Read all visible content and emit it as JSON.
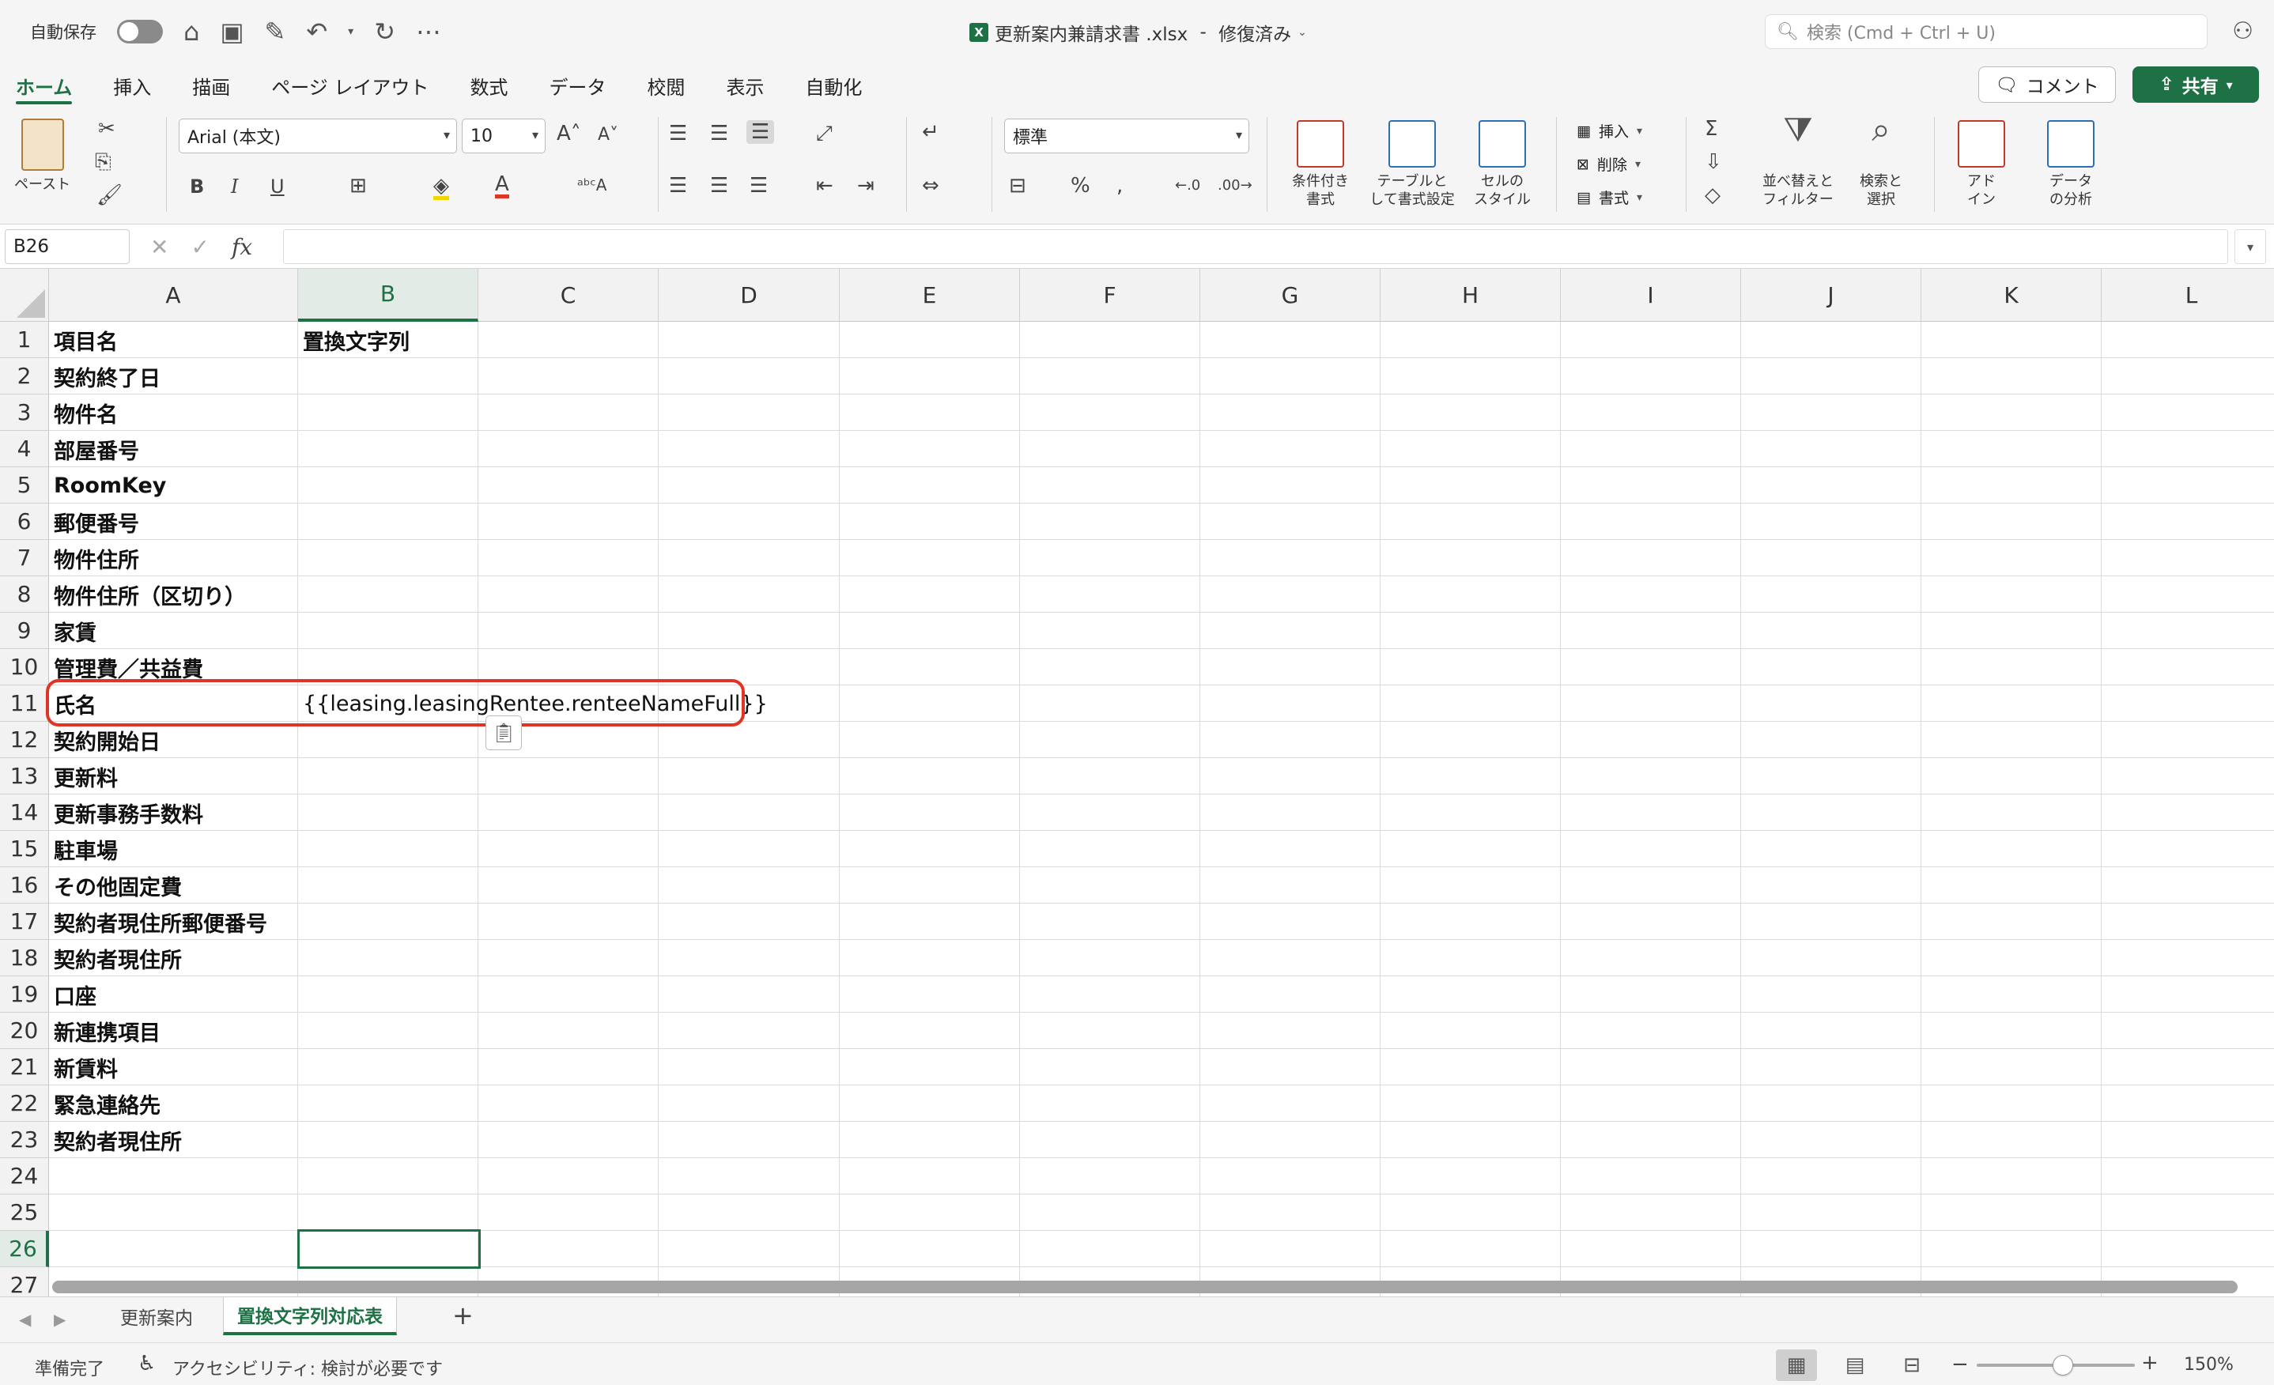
{
  "titlebar": {
    "autosave_label": "自動保存",
    "document_title": "更新案内兼請求書 .xlsx",
    "document_status": "修復済み",
    "search_placeholder": "検索 (Cmd + Ctrl + U)"
  },
  "ribbon_tabs": [
    "ホーム",
    "挿入",
    "描画",
    "ページ レイアウト",
    "数式",
    "データ",
    "校閲",
    "表示",
    "自動化"
  ],
  "active_tab": "ホーム",
  "actions": {
    "comment_label": "コメント",
    "share_label": "共有"
  },
  "ribbon": {
    "paste_label": "ペースト",
    "font_name": "Arial (本文)",
    "font_size": "10",
    "number_format": "標準",
    "conditional_format_label_1": "条件付き",
    "conditional_format_label_2": "書式",
    "table_format_label_1": "テーブルと",
    "table_format_label_2": "して書式設定",
    "cell_style_label_1": "セルの",
    "cell_style_label_2": "スタイル",
    "insert_label": "挿入",
    "delete_label": "削除",
    "format_label": "書式",
    "sort_filter_label_1": "並べ替えと",
    "sort_filter_label_2": "フィルター",
    "find_select_label_1": "検索と",
    "find_select_label_2": "選択",
    "addin_label_1": "アド",
    "addin_label_2": "イン",
    "data_analysis_label_1": "データ",
    "data_analysis_label_2": "の分析"
  },
  "formula_bar": {
    "name_box": "B26",
    "fx_label": "fx",
    "content": ""
  },
  "columns": [
    "A",
    "B",
    "C",
    "D",
    "E",
    "F",
    "G",
    "H",
    "I",
    "J",
    "K",
    "L"
  ],
  "rows": [
    "1",
    "2",
    "3",
    "4",
    "5",
    "6",
    "7",
    "8",
    "9",
    "10",
    "11",
    "12",
    "13",
    "14",
    "15",
    "16",
    "17",
    "18",
    "19",
    "20",
    "21",
    "22",
    "23",
    "24",
    "25",
    "26",
    "27"
  ],
  "cells": {
    "A1": "項目名",
    "B1": "置換文字列",
    "A2": "契約終了日",
    "A3": "物件名",
    "A4": "部屋番号",
    "A5": "RoomKey",
    "A6": "郵便番号",
    "A7": "物件住所",
    "A8": "物件住所（区切り）",
    "A9": "家賃",
    "A10": "管理費／共益費",
    "A11": "氏名",
    "B11": "{{leasing.leasingRentee.renteeNameFull}}",
    "A12": "契約開始日",
    "A13": "更新料",
    "A14": "更新事務手数料",
    "A15": "駐車場",
    "A16": "その他固定費",
    "A17": "契約者現住所郵便番号",
    "A18": "契約者現住所",
    "A19": "口座",
    "A20": "新連携項目",
    "A21": "新賃料",
    "A22": "緊急連絡先",
    "A23": "契約者現住所"
  },
  "selected_cell": "B26",
  "sheet_tabs": [
    "更新案内",
    "置換文字列対応表"
  ],
  "active_sheet": "置換文字列対応表",
  "statusbar": {
    "ready": "準備完了",
    "accessibility": "アクセシビリティ: 検討が必要です",
    "zoom": "150%"
  },
  "colors": {
    "accent": "#1e7145",
    "highlight": "#e03524"
  },
  "icons": [
    "home-icon",
    "save-icon",
    "save-as-icon",
    "undo-icon",
    "redo-icon",
    "more-icon",
    "search-icon",
    "comment-icon",
    "share-icon",
    "paste-icon",
    "cut-icon",
    "copy-icon",
    "format-painter-icon",
    "autosum-icon",
    "find-icon"
  ]
}
